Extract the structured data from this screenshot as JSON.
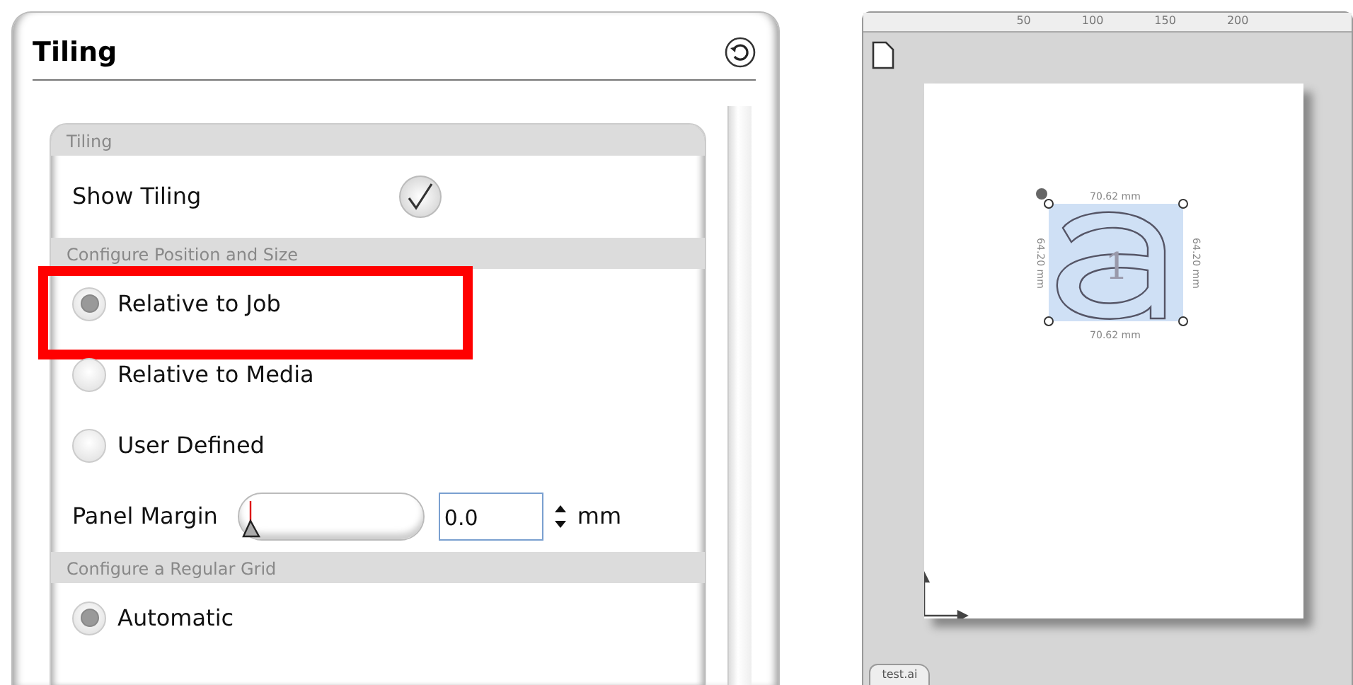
{
  "panel": {
    "title": "Tiling",
    "sections": [
      {
        "header": "Tiling",
        "rows": [
          {
            "kind": "checkbox",
            "label": "Show Tiling",
            "checked": true
          }
        ]
      },
      {
        "header": "Configure Position and Size",
        "rows": [
          {
            "kind": "radio",
            "label": "Relative to Job",
            "selected": true,
            "highlighted": true
          },
          {
            "kind": "radio",
            "label": "Relative to Media",
            "selected": false,
            "highlighted": false
          },
          {
            "kind": "radio",
            "label": "User Defined",
            "selected": false,
            "highlighted": false
          },
          {
            "kind": "slider",
            "label": "Panel Margin",
            "level": 0,
            "value": "0.0",
            "unit": "mm"
          }
        ]
      },
      {
        "header": "Configure a Regular Grid",
        "rows": [
          {
            "kind": "radio",
            "label": "Automatic",
            "selected": true,
            "highlighted": false
          }
        ]
      }
    ]
  },
  "canvas": {
    "ruler_ticks": [
      "50",
      "100",
      "150",
      "200"
    ],
    "artwork": {
      "job_number": "1",
      "width_top": "70.62 mm",
      "width_bottom": "70.62 mm",
      "height_left": "64.20 mm",
      "height_right": "64.20 mm"
    },
    "tab": "test.ai"
  }
}
